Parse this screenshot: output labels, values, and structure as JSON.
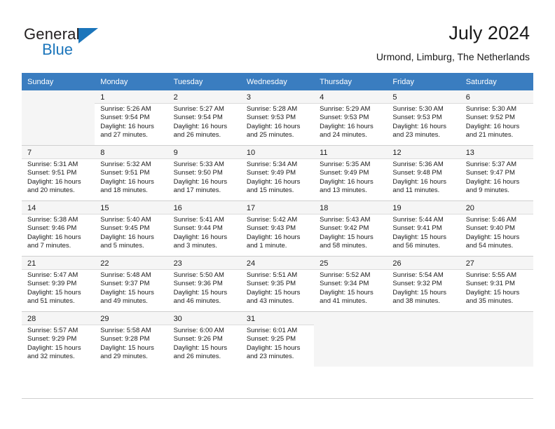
{
  "brand": {
    "name_part1": "General",
    "name_part2": "Blue",
    "accent_color": "#1b75bb"
  },
  "header": {
    "title": "July 2024",
    "subtitle": "Urmond, Limburg, The Netherlands"
  },
  "calendar": {
    "header_bg": "#3a7dc0",
    "weekday_headers": [
      "Sunday",
      "Monday",
      "Tuesday",
      "Wednesday",
      "Thursday",
      "Friday",
      "Saturday"
    ],
    "weeks": [
      [
        {
          "day": "",
          "lines": []
        },
        {
          "day": "1",
          "lines": [
            "Sunrise: 5:26 AM",
            "Sunset: 9:54 PM",
            "Daylight: 16 hours",
            "and 27 minutes."
          ]
        },
        {
          "day": "2",
          "lines": [
            "Sunrise: 5:27 AM",
            "Sunset: 9:54 PM",
            "Daylight: 16 hours",
            "and 26 minutes."
          ]
        },
        {
          "day": "3",
          "lines": [
            "Sunrise: 5:28 AM",
            "Sunset: 9:53 PM",
            "Daylight: 16 hours",
            "and 25 minutes."
          ]
        },
        {
          "day": "4",
          "lines": [
            "Sunrise: 5:29 AM",
            "Sunset: 9:53 PM",
            "Daylight: 16 hours",
            "and 24 minutes."
          ]
        },
        {
          "day": "5",
          "lines": [
            "Sunrise: 5:30 AM",
            "Sunset: 9:53 PM",
            "Daylight: 16 hours",
            "and 23 minutes."
          ]
        },
        {
          "day": "6",
          "lines": [
            "Sunrise: 5:30 AM",
            "Sunset: 9:52 PM",
            "Daylight: 16 hours",
            "and 21 minutes."
          ]
        }
      ],
      [
        {
          "day": "7",
          "lines": [
            "Sunrise: 5:31 AM",
            "Sunset: 9:51 PM",
            "Daylight: 16 hours",
            "and 20 minutes."
          ]
        },
        {
          "day": "8",
          "lines": [
            "Sunrise: 5:32 AM",
            "Sunset: 9:51 PM",
            "Daylight: 16 hours",
            "and 18 minutes."
          ]
        },
        {
          "day": "9",
          "lines": [
            "Sunrise: 5:33 AM",
            "Sunset: 9:50 PM",
            "Daylight: 16 hours",
            "and 17 minutes."
          ]
        },
        {
          "day": "10",
          "lines": [
            "Sunrise: 5:34 AM",
            "Sunset: 9:49 PM",
            "Daylight: 16 hours",
            "and 15 minutes."
          ]
        },
        {
          "day": "11",
          "lines": [
            "Sunrise: 5:35 AM",
            "Sunset: 9:49 PM",
            "Daylight: 16 hours",
            "and 13 minutes."
          ]
        },
        {
          "day": "12",
          "lines": [
            "Sunrise: 5:36 AM",
            "Sunset: 9:48 PM",
            "Daylight: 16 hours",
            "and 11 minutes."
          ]
        },
        {
          "day": "13",
          "lines": [
            "Sunrise: 5:37 AM",
            "Sunset: 9:47 PM",
            "Daylight: 16 hours",
            "and 9 minutes."
          ]
        }
      ],
      [
        {
          "day": "14",
          "lines": [
            "Sunrise: 5:38 AM",
            "Sunset: 9:46 PM",
            "Daylight: 16 hours",
            "and 7 minutes."
          ]
        },
        {
          "day": "15",
          "lines": [
            "Sunrise: 5:40 AM",
            "Sunset: 9:45 PM",
            "Daylight: 16 hours",
            "and 5 minutes."
          ]
        },
        {
          "day": "16",
          "lines": [
            "Sunrise: 5:41 AM",
            "Sunset: 9:44 PM",
            "Daylight: 16 hours",
            "and 3 minutes."
          ]
        },
        {
          "day": "17",
          "lines": [
            "Sunrise: 5:42 AM",
            "Sunset: 9:43 PM",
            "Daylight: 16 hours",
            "and 1 minute."
          ]
        },
        {
          "day": "18",
          "lines": [
            "Sunrise: 5:43 AM",
            "Sunset: 9:42 PM",
            "Daylight: 15 hours",
            "and 58 minutes."
          ]
        },
        {
          "day": "19",
          "lines": [
            "Sunrise: 5:44 AM",
            "Sunset: 9:41 PM",
            "Daylight: 15 hours",
            "and 56 minutes."
          ]
        },
        {
          "day": "20",
          "lines": [
            "Sunrise: 5:46 AM",
            "Sunset: 9:40 PM",
            "Daylight: 15 hours",
            "and 54 minutes."
          ]
        }
      ],
      [
        {
          "day": "21",
          "lines": [
            "Sunrise: 5:47 AM",
            "Sunset: 9:39 PM",
            "Daylight: 15 hours",
            "and 51 minutes."
          ]
        },
        {
          "day": "22",
          "lines": [
            "Sunrise: 5:48 AM",
            "Sunset: 9:37 PM",
            "Daylight: 15 hours",
            "and 49 minutes."
          ]
        },
        {
          "day": "23",
          "lines": [
            "Sunrise: 5:50 AM",
            "Sunset: 9:36 PM",
            "Daylight: 15 hours",
            "and 46 minutes."
          ]
        },
        {
          "day": "24",
          "lines": [
            "Sunrise: 5:51 AM",
            "Sunset: 9:35 PM",
            "Daylight: 15 hours",
            "and 43 minutes."
          ]
        },
        {
          "day": "25",
          "lines": [
            "Sunrise: 5:52 AM",
            "Sunset: 9:34 PM",
            "Daylight: 15 hours",
            "and 41 minutes."
          ]
        },
        {
          "day": "26",
          "lines": [
            "Sunrise: 5:54 AM",
            "Sunset: 9:32 PM",
            "Daylight: 15 hours",
            "and 38 minutes."
          ]
        },
        {
          "day": "27",
          "lines": [
            "Sunrise: 5:55 AM",
            "Sunset: 9:31 PM",
            "Daylight: 15 hours",
            "and 35 minutes."
          ]
        }
      ],
      [
        {
          "day": "28",
          "lines": [
            "Sunrise: 5:57 AM",
            "Sunset: 9:29 PM",
            "Daylight: 15 hours",
            "and 32 minutes."
          ]
        },
        {
          "day": "29",
          "lines": [
            "Sunrise: 5:58 AM",
            "Sunset: 9:28 PM",
            "Daylight: 15 hours",
            "and 29 minutes."
          ]
        },
        {
          "day": "30",
          "lines": [
            "Sunrise: 6:00 AM",
            "Sunset: 9:26 PM",
            "Daylight: 15 hours",
            "and 26 minutes."
          ]
        },
        {
          "day": "31",
          "lines": [
            "Sunrise: 6:01 AM",
            "Sunset: 9:25 PM",
            "Daylight: 15 hours",
            "and 23 minutes."
          ]
        },
        {
          "day": "",
          "lines": []
        },
        {
          "day": "",
          "lines": []
        },
        {
          "day": "",
          "lines": []
        }
      ]
    ]
  }
}
